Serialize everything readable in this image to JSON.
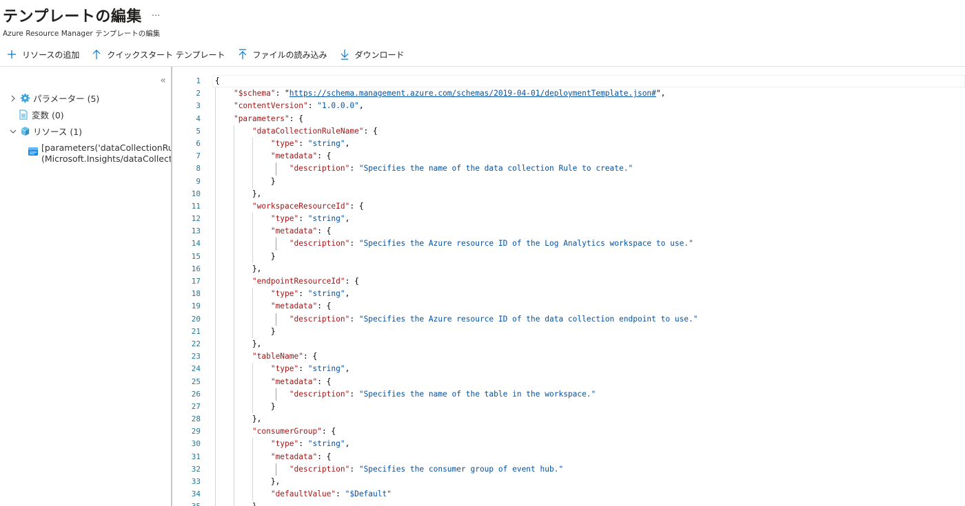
{
  "header": {
    "title": "テンプレートの編集",
    "more": "···",
    "subtitle": "Azure Resource Manager テンプレートの編集"
  },
  "toolbar": {
    "add_resource": "リソースの追加",
    "quickstart": "クイックスタート テンプレート",
    "load_file": "ファイルの読み込み",
    "download": "ダウンロード"
  },
  "sidebar": {
    "collapse": "«",
    "parameters": "パラメーター (5)",
    "variables": "変数 (0)",
    "resources": "リソース (1)",
    "resource_line1": "[parameters('dataCollectionRuleName')]",
    "resource_line2": "(Microsoft.Insights/dataCollectionRules)"
  },
  "editor": {
    "line_numbers": [
      "1",
      "2",
      "3",
      "4",
      "5",
      "6",
      "7",
      "8",
      "9",
      "10",
      "11",
      "12",
      "13",
      "14",
      "15",
      "16",
      "17",
      "18",
      "19",
      "20",
      "21",
      "22",
      "23",
      "24",
      "25",
      "26",
      "27",
      "28",
      "29",
      "30",
      "31",
      "32",
      "33",
      "34",
      "35"
    ],
    "code": {
      "l1": "{",
      "schema_key": "\"$schema\"",
      "schema_url": "https://schema.management.azure.com/schemas/2019-04-01/deploymentTemplate.json#",
      "content_version_key": "\"contentVersion\"",
      "content_version_val": "\"1.0.0.0\"",
      "parameters_key": "\"parameters\"",
      "p1_key": "\"dataCollectionRuleName\"",
      "p2_key": "\"workspaceResourceId\"",
      "p3_key": "\"endpointResourceId\"",
      "p4_key": "\"tableName\"",
      "p5_key": "\"consumerGroup\"",
      "type_key": "\"type\"",
      "type_val": "\"string\"",
      "metadata_key": "\"metadata\"",
      "description_key": "\"description\"",
      "d1": "\"Specifies the name of the data collection Rule to create.\"",
      "d2": "\"Specifies the Azure resource ID of the Log Analytics workspace to use.\"",
      "d3": "\"Specifies the Azure resource ID of the data collection endpoint to use.\"",
      "d4": "\"Specifies the name of the table in the workspace.\"",
      "d5": "\"Specifies the consumer group of event hub.\"",
      "default_key": "\"defaultValue\"",
      "default_val": "\"$Default\""
    }
  },
  "colors": {
    "key": "#a31515",
    "string": "#0451a5",
    "line_number": "#237893",
    "accent": "#0078d4"
  }
}
